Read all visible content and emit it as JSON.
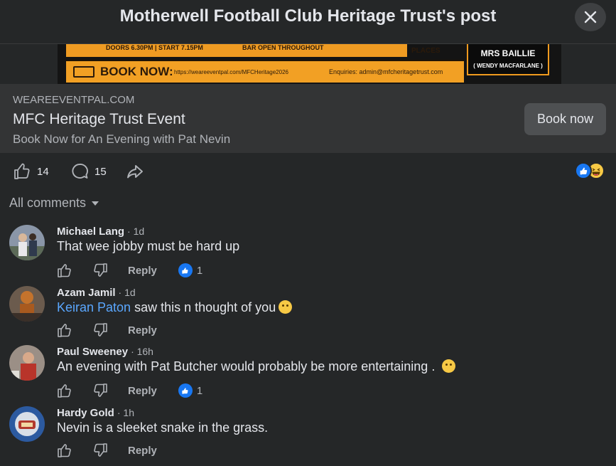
{
  "header": {
    "title": "Motherwell Football Club Heritage Trust's post",
    "close_icon": "close-icon"
  },
  "poster": {
    "doors_text": "DOORS 6.30PM | START 7.15PM",
    "bar_text": "BAR OPEN THROUGHOUT",
    "places_text": "PLACES",
    "book_label": "BOOK NOW:",
    "book_url": "https://weareeventpal.com/MFCHeritage2026",
    "enquiries": "Enquiries: admin@mfcheritagetrust.com",
    "card_name": "MRS BAILLIE",
    "card_sub": "( WENDY MACFARLANE )"
  },
  "link_preview": {
    "domain": "WEAREEVENTPAL.COM",
    "title": "MFC Heritage Trust Event",
    "description": "Book Now for An Evening with Pat Nevin",
    "button_label": "Book now"
  },
  "post_actions": {
    "like_count": "14",
    "comment_count": "15",
    "reactions": [
      "like",
      "haha"
    ]
  },
  "comments_sort": {
    "label": "All comments"
  },
  "comments": [
    {
      "author": "Michael Lang",
      "time": "· 1d",
      "mention": "",
      "text": "That wee jobby must be hard up",
      "emoji": "",
      "reply_label": "Reply",
      "reaction_count": "1"
    },
    {
      "author": "Azam Jamil",
      "time": "· 1d",
      "mention": "Keiran Paton",
      "text": " saw this n thought of you",
      "emoji": "laughing-emoji",
      "reply_label": "Reply",
      "reaction_count": ""
    },
    {
      "author": "Paul Sweeney",
      "time": "· 16h",
      "mention": "",
      "text": "An evening with Pat Butcher would probably be more entertaining .",
      "emoji": "wink-emoji",
      "reply_label": "Reply",
      "reaction_count": "1"
    },
    {
      "author": "Hardy Gold",
      "time": "· 1h",
      "mention": "",
      "text": "Nevin is a sleeket snake in the grass.",
      "emoji": "",
      "reply_label": "Reply",
      "reaction_count": ""
    }
  ],
  "colors": {
    "background": "#252728",
    "panel": "#333435",
    "accent": "#1877f2",
    "mention": "#5aa7ff",
    "muted_text": "#b0b3b8"
  }
}
